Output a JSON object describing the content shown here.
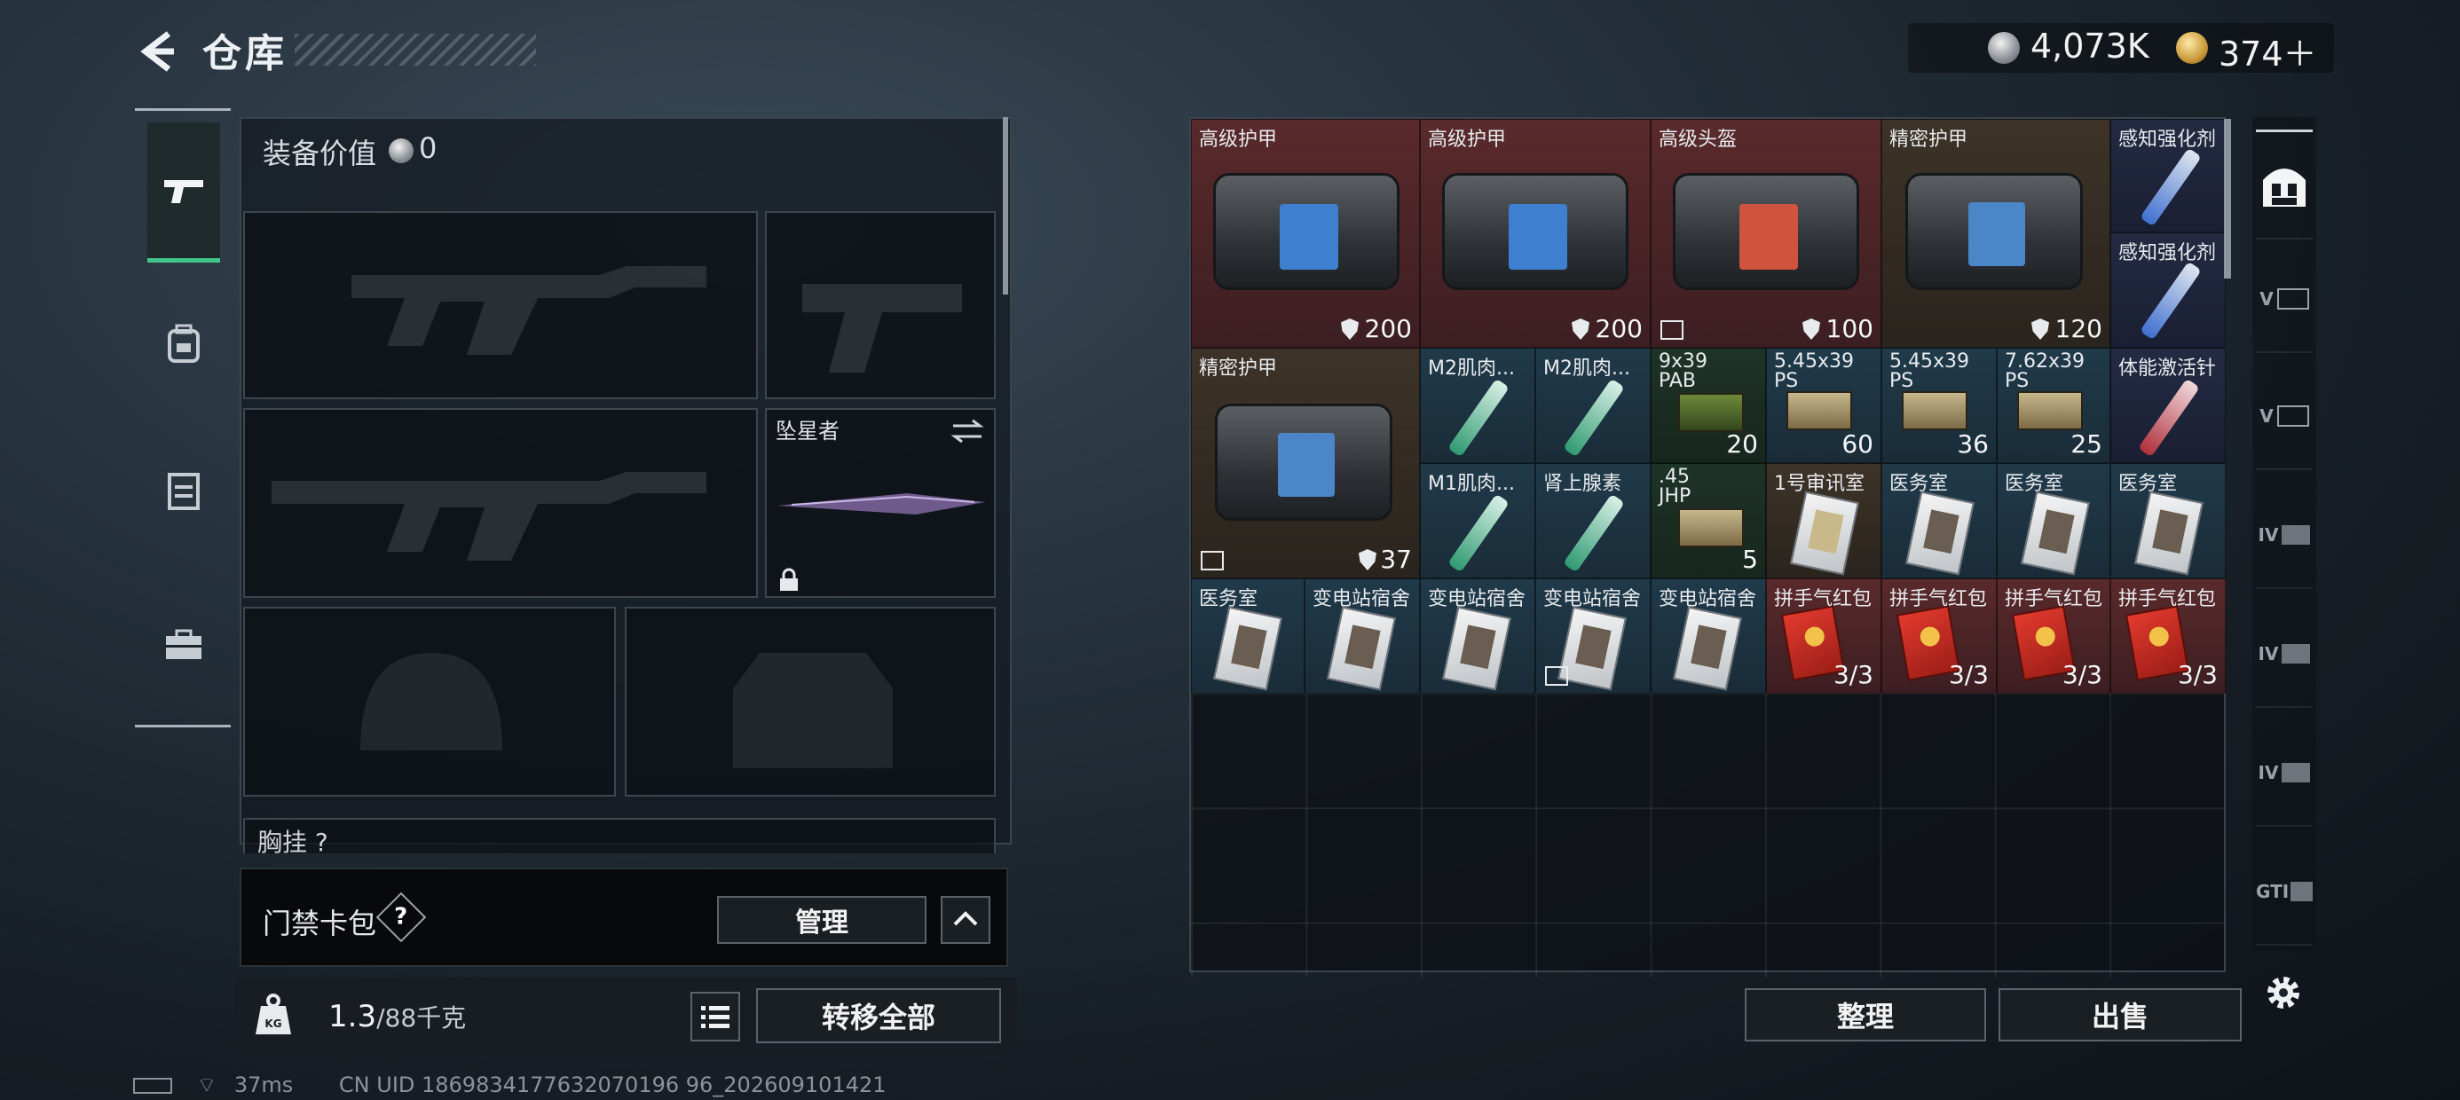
{
  "header": {
    "title": "仓库"
  },
  "currency": {
    "silver": "4,073K",
    "gold": "374＋"
  },
  "equipment": {
    "value_label": "装备价值",
    "value": "0",
    "melee_name": "坠星者",
    "chest_label": "胸挂 ?"
  },
  "keycard": {
    "label": "门禁卡包",
    "help": "?",
    "manage": "管理"
  },
  "weight": {
    "current": "1.3",
    "capacity": "/88千克",
    "transfer_all": "转移全部"
  },
  "status": {
    "ping": "37ms",
    "uid": "CN UID 1869834177632070196 96_202609101421"
  },
  "storage": {
    "organize": "整理",
    "sell": "出售",
    "items": [
      {
        "name": "高级护甲",
        "count": "200"
      },
      {
        "name": "高级护甲",
        "count": "200"
      },
      {
        "name": "高级头盔",
        "count": "100"
      },
      {
        "name": "精密护甲",
        "count": "120"
      },
      {
        "name": "感知强化剂",
        "count": ""
      },
      {
        "name": "感知强化剂",
        "count": ""
      },
      {
        "name": "精密护甲",
        "count": "37"
      },
      {
        "name": "M2肌肉...",
        "count": ""
      },
      {
        "name": "M2肌肉...",
        "count": ""
      },
      {
        "name": "9x39 PAB",
        "count": "20"
      },
      {
        "name": "5.45x39 PS",
        "count": "60"
      },
      {
        "name": "5.45x39 PS",
        "count": "36"
      },
      {
        "name": "7.62x39 PS",
        "count": "25"
      },
      {
        "name": "体能激活针",
        "count": ""
      },
      {
        "name": "M1肌肉...",
        "count": ""
      },
      {
        "name": "肾上腺素",
        "count": ""
      },
      {
        "name": ".45 JHP",
        "count": "5"
      },
      {
        "name": "1号审讯室",
        "count": ""
      },
      {
        "name": "医务室",
        "count": ""
      },
      {
        "name": "医务室",
        "count": ""
      },
      {
        "name": "医务室",
        "count": ""
      },
      {
        "name": "医务室",
        "count": ""
      },
      {
        "name": "变电站宿舍",
        "count": ""
      },
      {
        "name": "变电站宿舍",
        "count": ""
      },
      {
        "name": "变电站宿舍",
        "count": ""
      },
      {
        "name": "变电站宿舍",
        "count": ""
      },
      {
        "name": "拼手气红包",
        "count": "3/3"
      },
      {
        "name": "拼手气红包",
        "count": "3/3"
      },
      {
        "name": "拼手气红包",
        "count": "3/3"
      },
      {
        "name": "拼手气红包",
        "count": "3/3"
      }
    ]
  },
  "side_rail": {
    "labels": [
      "V",
      "V",
      "IV",
      "IV",
      "IV",
      "GTI"
    ]
  }
}
